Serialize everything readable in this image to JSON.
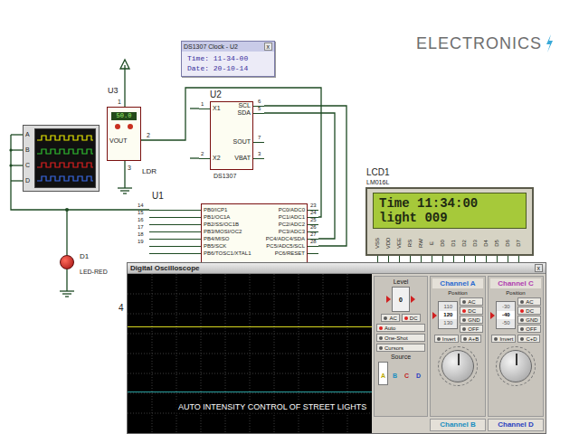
{
  "logo": {
    "text": "ELECTRONICS"
  },
  "clock_popup": {
    "title": "DS1307 Clock - U2",
    "close": "x",
    "time": "Time: 11-34-00",
    "date": "Date: 20-10-14"
  },
  "u3": {
    "ref": "U3",
    "type": "LDR",
    "display": "50.0",
    "out_label": "VOUT",
    "pin_top": "1",
    "pin_out": "2",
    "pin_bottom": "3"
  },
  "u2": {
    "ref": "U2",
    "type": "DS1307",
    "left_pins": [
      {
        "label": "X1",
        "num": "1"
      },
      {
        "label": "X2",
        "num": "2"
      }
    ],
    "right_pins": [
      {
        "label": "SCL",
        "num": "6"
      },
      {
        "label": "SDA",
        "num": "5"
      },
      {
        "label": "SOUT",
        "num": "7"
      },
      {
        "label": "VBAT",
        "num": "3"
      }
    ]
  },
  "logic_scope": {
    "channels": [
      {
        "label": "A",
        "color": "#e8e800"
      },
      {
        "label": "B",
        "color": "#30c030"
      },
      {
        "label": "C",
        "color": "#e02020"
      },
      {
        "label": "D",
        "color": "#3a6ae8"
      }
    ]
  },
  "d1": {
    "ref": "D1",
    "type": "LED-RED"
  },
  "u1": {
    "ref": "U1",
    "left_pins": [
      {
        "num": "14",
        "label": "PB0/ICP1"
      },
      {
        "num": "15",
        "label": "PB1/OC1A"
      },
      {
        "num": "16",
        "label": "PB2/SS/OC1B"
      },
      {
        "num": "17",
        "label": "PB3/MOSI/OC2"
      },
      {
        "num": "18",
        "label": "PB4/MISO"
      },
      {
        "num": "19",
        "label": "PB5/SCK"
      },
      {
        "label": "PB6/TOSC1/XTAL1"
      }
    ],
    "right_pins": [
      {
        "num": "23",
        "label": "PC0/ADC0"
      },
      {
        "num": "24",
        "label": "PC1/ADC1"
      },
      {
        "num": "25",
        "label": "PC2/ADC2"
      },
      {
        "num": "26",
        "label": "PC3/ADC3"
      },
      {
        "num": "27",
        "label": "PC4/ADC4/SDA"
      },
      {
        "num": "28",
        "label": "PC5/ADC5/SCL"
      },
      {
        "label": "PC6/RESET"
      }
    ]
  },
  "stray_label": "4",
  "lcd": {
    "ref": "LCD1",
    "type": "LM016L",
    "lines": [
      "Time 11:34:00",
      "light 009"
    ],
    "pins": [
      "VSS",
      "VDD",
      "VEE",
      "RS",
      "RW",
      "E",
      "D0",
      "D1",
      "D2",
      "D3",
      "D4",
      "D5",
      "D6",
      "D7"
    ]
  },
  "oscilloscope": {
    "title": "Digital Oscilloscope",
    "close": "x",
    "traces": [
      {
        "color": "#d8d820",
        "level": 0.67
      },
      {
        "color": "#2aa0a0",
        "level": 0.26
      }
    ],
    "trigger": {
      "level_label": "Level",
      "readout": "0",
      "coupling": [
        {
          "label": "AC",
          "selected": false
        },
        {
          "label": "DC",
          "selected": true
        }
      ],
      "modes": [
        {
          "label": "Auto",
          "selected": true
        },
        {
          "label": "One-Shot",
          "selected": false
        },
        {
          "label": "Cursors",
          "selected": false
        }
      ],
      "source_label": "Source",
      "sources": [
        {
          "label": "A",
          "selected": true,
          "color": "#b8a800"
        },
        {
          "label": "B",
          "selected": false,
          "color": "#1a8fc0"
        },
        {
          "label": "C",
          "selected": false,
          "color": "#c02020"
        },
        {
          "label": "D",
          "selected": false,
          "color": "#2a40c0"
        }
      ]
    },
    "channels": [
      {
        "title": "Channel A",
        "color": "#2a6ad0",
        "position_label": "Position",
        "readout": [
          "110",
          "120",
          "130"
        ],
        "coupling": [
          {
            "label": "AC",
            "selected": false
          },
          {
            "label": "DC",
            "selected": true
          },
          {
            "label": "GND",
            "selected": false
          },
          {
            "label": "OFF",
            "selected": false
          }
        ],
        "extras": [
          {
            "label": "Invert",
            "selected": false
          },
          {
            "label": "A+B",
            "selected": false
          }
        ]
      },
      {
        "title": "Channel C",
        "color": "#b03cb0",
        "position_label": "Position",
        "readout": [
          "-30",
          "-40",
          "-50"
        ],
        "coupling": [
          {
            "label": "AC",
            "selected": false
          },
          {
            "label": "DC",
            "selected": true
          },
          {
            "label": "GND",
            "selected": false
          },
          {
            "label": "OFF",
            "selected": false
          }
        ],
        "extras": [
          {
            "label": "Invert",
            "selected": false
          },
          {
            "label": "C+D",
            "selected": false
          }
        ]
      }
    ],
    "collapsed_channels": [
      {
        "title": "Channel B",
        "color": "#1a8fc0"
      },
      {
        "title": "Channel D",
        "color": "#2a40c0"
      }
    ],
    "caption": "AUTO INTENSITY CONTROL OF STREET LIGHTS"
  }
}
